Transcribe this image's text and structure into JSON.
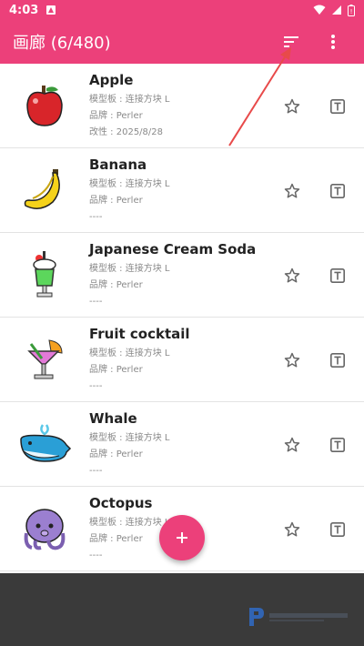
{
  "status": {
    "time": "4:03"
  },
  "app_bar": {
    "title": "画廊 (6/480)"
  },
  "items": [
    {
      "name": "Apple",
      "board": "模型板 : 连接方块 L",
      "brand": "品牌 : Perler",
      "extra": "改性 : 2025/8/28"
    },
    {
      "name": "Banana",
      "board": "模型板 : 连接方块 L",
      "brand": "品牌 : Perler",
      "extra": "----"
    },
    {
      "name": "Japanese Cream Soda",
      "board": "模型板 : 连接方块 L",
      "brand": "品牌 : Perler",
      "extra": "----"
    },
    {
      "name": "Fruit cocktail",
      "board": "模型板 : 连接方块 L",
      "brand": "品牌 : Perler",
      "extra": "----"
    },
    {
      "name": "Whale",
      "board": "模型板 : 连接方块 L",
      "brand": "品牌 : Perler",
      "extra": "----"
    },
    {
      "name": "Octopus",
      "board": "模型板 : 连接方块 L",
      "brand": "品牌 : Perler",
      "extra": "----"
    }
  ],
  "colors": {
    "accent": "#ec407a"
  },
  "icons": {
    "sort": "sort-icon",
    "more": "more-vert-icon",
    "favorite": "star-outline-icon",
    "text": "text-box-icon",
    "add": "add-icon"
  }
}
